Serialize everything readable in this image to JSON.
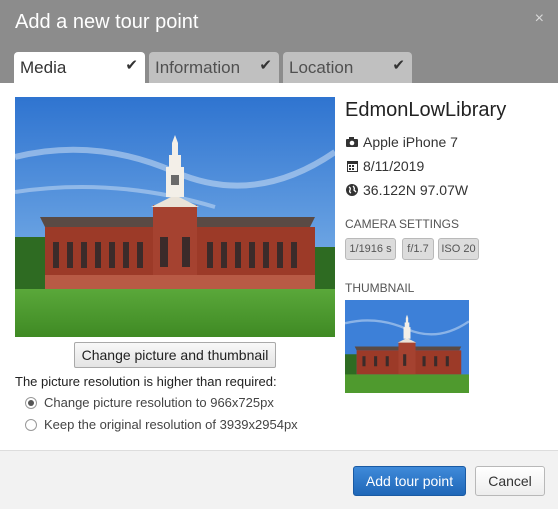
{
  "dialog": {
    "title": "Add a new tour point",
    "close_glyph": "×"
  },
  "tabs": [
    {
      "label": "Media",
      "active": true,
      "completed": true
    },
    {
      "label": "Information",
      "active": false,
      "completed": true
    },
    {
      "label": "Location",
      "active": false,
      "completed": true
    }
  ],
  "media": {
    "photo_title": "EdmonLowLibrary",
    "camera": "Apple iPhone 7",
    "date": "8/11/2019",
    "coordinates": "36.122N 97.07W",
    "camera_settings_label": "CAMERA SETTINGS",
    "settings": {
      "shutter": "1/1916 s",
      "aperture": "f/1.7",
      "iso": "ISO 20"
    },
    "thumbnail_label": "THUMBNAIL",
    "change_button": "Change picture and thumbnail",
    "resolution_heading": "The picture resolution is higher than required:",
    "resolution_options": [
      {
        "label": "Change picture resolution to 966x725px",
        "selected": true
      },
      {
        "label": "Keep the original resolution of 3939x2954px",
        "selected": false
      }
    ]
  },
  "footer": {
    "add_button": "Add tour point",
    "cancel_button": "Cancel"
  },
  "icons": {
    "check": "check-icon",
    "camera": "camera-icon",
    "calendar": "calendar-icon",
    "globe": "globe-icon"
  },
  "colors": {
    "header": "#8c8c8c",
    "primary_button": "#2a74c6",
    "sky": "#4a8ee0",
    "lawn": "#4f9a2e",
    "brick": "#9c3a28"
  }
}
